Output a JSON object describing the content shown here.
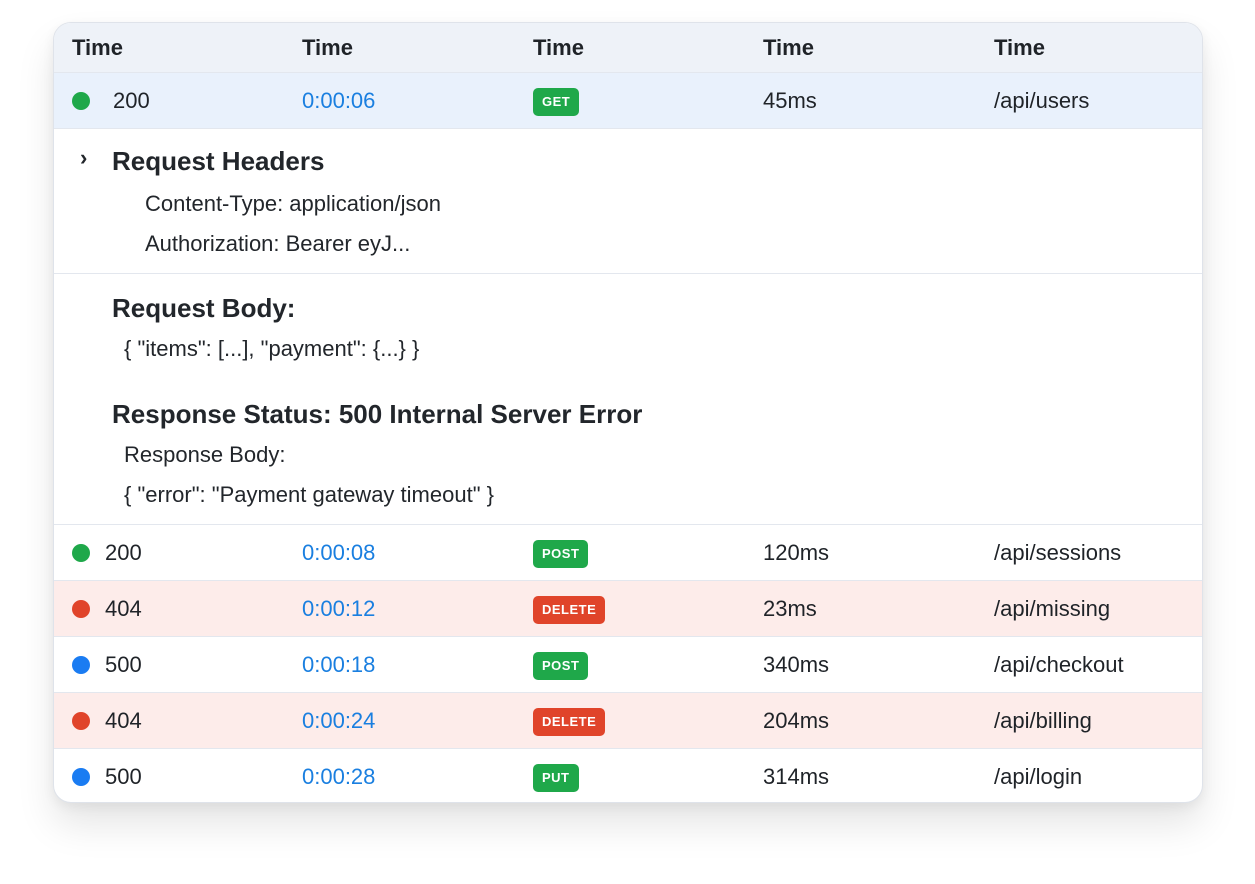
{
  "columns": [
    "Time",
    "Time",
    "Time",
    "Time",
    "Time"
  ],
  "selected_row": {
    "status": "200",
    "status_color": "#1fa84a",
    "time": "0:00:06",
    "method": "GET",
    "duration": "45ms",
    "path": "/api/users"
  },
  "details": {
    "request_headers_title": "Request Headers",
    "headers": [
      "Content-Type: application/json",
      "Authorization: Bearer eyJ..."
    ],
    "request_body_title": "Request Body:",
    "request_body": "{ \"items\": [...], \"payment\": {...} }",
    "response_status_title": "Response Status: 500 Internal Server Error",
    "response_body_label": "Response Body:",
    "response_body": "{ \"error\": \"Payment gateway timeout\" }"
  },
  "rows": [
    {
      "status": "200",
      "dot": "green",
      "time": "0:00:08",
      "method": "POST",
      "method_color": "green",
      "duration": "120ms",
      "path": "/api/sessions"
    },
    {
      "status": "404",
      "dot": "red",
      "time": "0:00:12",
      "method": "DELETE",
      "method_color": "red",
      "duration": "23ms",
      "path": "/api/missing"
    },
    {
      "status": "500",
      "dot": "blue",
      "time": "0:00:18",
      "method": "POST",
      "method_color": "green",
      "duration": "340ms",
      "path": "/api/checkout"
    },
    {
      "status": "404",
      "dot": "red",
      "time": "0:00:24",
      "method": "DELETE",
      "method_color": "red",
      "duration": "204ms",
      "path": "/api/billing"
    },
    {
      "status": "500",
      "dot": "blue",
      "time": "0:00:28",
      "method": "PUT",
      "method_color": "green",
      "duration": "314ms",
      "path": "/api/login"
    }
  ],
  "colors": {
    "green": "#1fa84a",
    "red": "#e0442a",
    "blue": "#1a7cf2",
    "time_link": "#1a7fe0",
    "selected_bg": "#e9f1fc",
    "error_bg": "#fdecea"
  }
}
